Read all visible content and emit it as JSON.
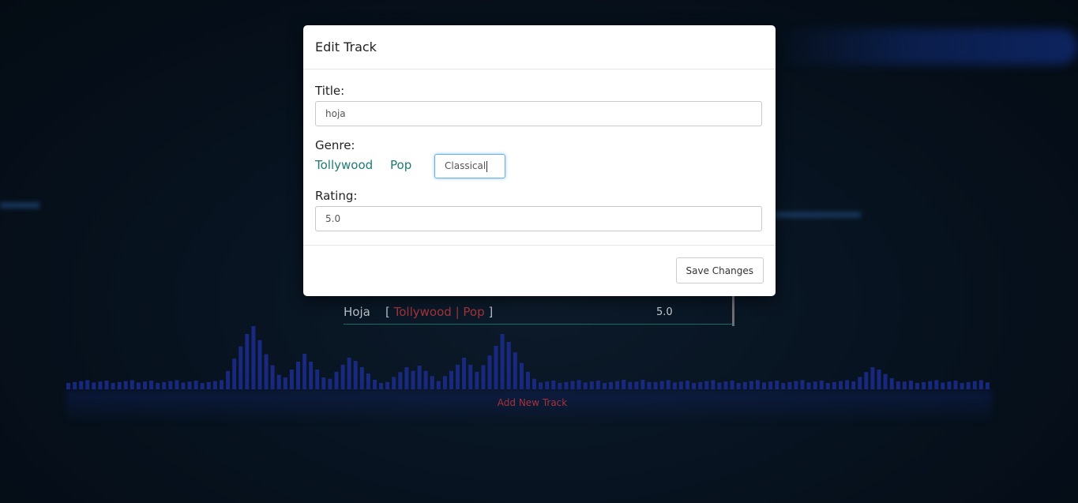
{
  "modal": {
    "title": "Edit Track",
    "fields": {
      "title_label": "Title:",
      "title_value": "hoja",
      "genre_label": "Genre:",
      "genres": [
        "Tollywood",
        "Pop"
      ],
      "genre_input_value": "Classical",
      "rating_label": "Rating:",
      "rating_value": "5.0"
    },
    "save_label": "Save Changes"
  },
  "track_list": {
    "rows": [
      {
        "title": "Hoja",
        "genre_open": "[",
        "genres": [
          "Tollywood",
          "Pop"
        ],
        "genre_sep": "|",
        "genre_close": "]",
        "rating": "5.0"
      }
    ]
  },
  "add_track_label": "Add New Track",
  "colors": {
    "accent_link": "#1d7a75",
    "genre_tag": "#a5343a",
    "background": "#071320",
    "wave_bars": "#1b2d8f"
  }
}
